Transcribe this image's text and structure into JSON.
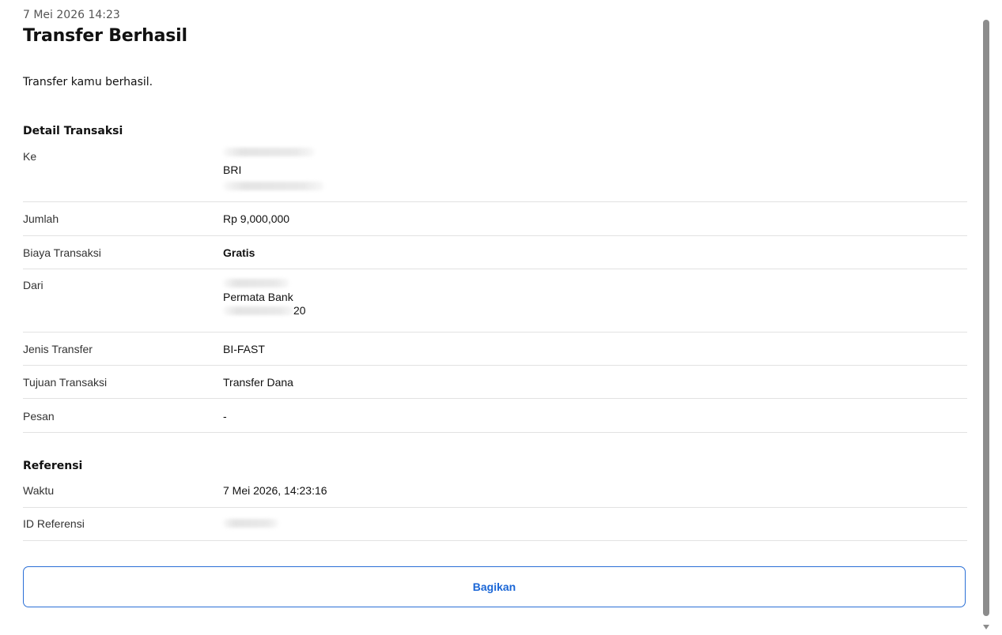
{
  "header": {
    "timestamp": "7 Mei 2026 14:23",
    "title": "Transfer Berhasil",
    "message": "Transfer kamu berhasil."
  },
  "detail": {
    "section_title": "Detail Transaksi",
    "to": {
      "label": "Ke",
      "bank": "BRI"
    },
    "amount": {
      "label": "Jumlah",
      "value": "Rp 9,000,000"
    },
    "fee": {
      "label": "Biaya Transaksi",
      "value": "Gratis"
    },
    "from": {
      "label": "Dari",
      "bank": "Permata Bank",
      "account_suffix": "20"
    },
    "transfer_type": {
      "label": "Jenis Transfer",
      "value": "BI-FAST"
    },
    "purpose": {
      "label": "Tujuan Transaksi",
      "value": "Transfer Dana"
    },
    "note": {
      "label": "Pesan",
      "value": "-"
    }
  },
  "reference": {
    "section_title": "Referensi",
    "time": {
      "label": "Waktu",
      "value": "7 Mei 2026, 14:23:16"
    },
    "ref_id": {
      "label": "ID Referensi"
    }
  },
  "actions": {
    "share_label": "Bagikan"
  },
  "colors": {
    "accent": "#1a66d6",
    "divider": "#e2e2e2",
    "scrollbar": "#8c8c8c"
  }
}
